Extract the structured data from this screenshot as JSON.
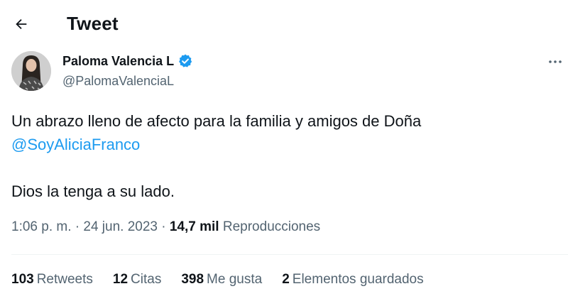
{
  "header": {
    "back_icon": "arrow-left-icon",
    "title": "Tweet"
  },
  "author": {
    "display_name": "Paloma Valencia L",
    "handle": "@PalomaValenciaL",
    "verified_icon": "verified-badge-icon",
    "verified_color": "#1d9bf0",
    "more_icon": "more-horizontal-icon"
  },
  "tweet": {
    "line1_text": "Un abrazo lleno de afecto para la familia y amigos de Doña",
    "mention": "@SoyAliciaFranco",
    "line2_text": "Dios la tenga a su lado."
  },
  "meta": {
    "time": "1:06 p. m.",
    "separator": "·",
    "date": "24 jun. 2023",
    "views_count": "14,7 mil",
    "views_label": "Reproducciones"
  },
  "stats": [
    {
      "count": "103",
      "label": "Retweets"
    },
    {
      "count": "12",
      "label": "Citas"
    },
    {
      "count": "398",
      "label": "Me gusta"
    },
    {
      "count": "2",
      "label": "Elementos guardados"
    }
  ],
  "colors": {
    "text": "#0f1419",
    "secondary": "#536471",
    "link": "#1d9bf0",
    "divider": "#eff3f4"
  }
}
